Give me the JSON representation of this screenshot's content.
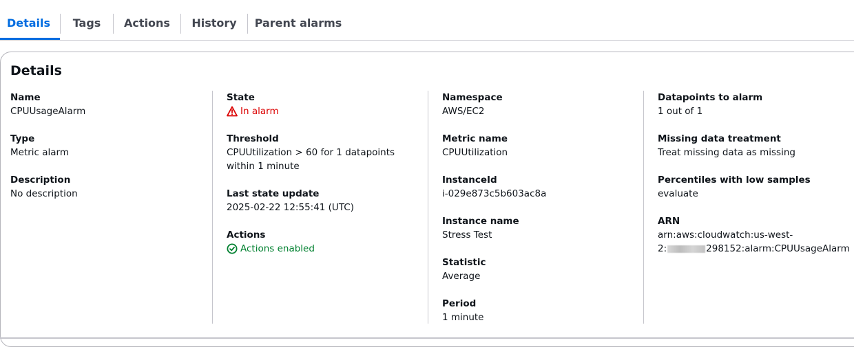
{
  "tabs": [
    {
      "label": "Details",
      "active": true
    },
    {
      "label": "Tags",
      "active": false
    },
    {
      "label": "Actions",
      "active": false
    },
    {
      "label": "History",
      "active": false
    },
    {
      "label": "Parent alarms",
      "active": false
    }
  ],
  "colors": {
    "accent": "#006ce0",
    "alarm_red": "#db0000",
    "enabled_green": "#00802f"
  },
  "details": {
    "title": "Details",
    "col1": {
      "name_label": "Name",
      "name_value": "CPUUsageAlarm",
      "type_label": "Type",
      "type_value": "Metric alarm",
      "description_label": "Description",
      "description_value": "No description"
    },
    "col2": {
      "state_label": "State",
      "state_value": "In alarm",
      "state_icon": "warning-triangle-icon",
      "threshold_label": "Threshold",
      "threshold_line1": "CPUUtilization > 60 for 1 datapoints",
      "threshold_line2": "within 1 minute",
      "last_update_label": "Last state update",
      "last_update_value": "2025-02-22 12:55:41 (UTC)",
      "actions_label": "Actions",
      "actions_value": "Actions enabled",
      "actions_icon": "check-circle-icon"
    },
    "col3": {
      "namespace_label": "Namespace",
      "namespace_value": "AWS/EC2",
      "metric_name_label": "Metric name",
      "metric_name_value": "CPUUtilization",
      "instance_id_label": "InstanceId",
      "instance_id_value": "i-029e873c5b603ac8a",
      "instance_name_label": "Instance name",
      "instance_name_value": "Stress Test",
      "statistic_label": "Statistic",
      "statistic_value": "Average",
      "period_label": "Period",
      "period_value": "1 minute"
    },
    "col4": {
      "datapoints_label": "Datapoints to alarm",
      "datapoints_value": "1 out of 1",
      "missing_label": "Missing data treatment",
      "missing_value": "Treat missing data as missing",
      "percentiles_label": "Percentiles with low samples",
      "percentiles_value": "evaluate",
      "arn_label": "ARN",
      "arn_line1": "arn:aws:cloudwatch:us-west-",
      "arn_line2_prefix": "2:",
      "arn_line2_suffix": "298152:alarm:CPUUsageAlarm"
    }
  }
}
